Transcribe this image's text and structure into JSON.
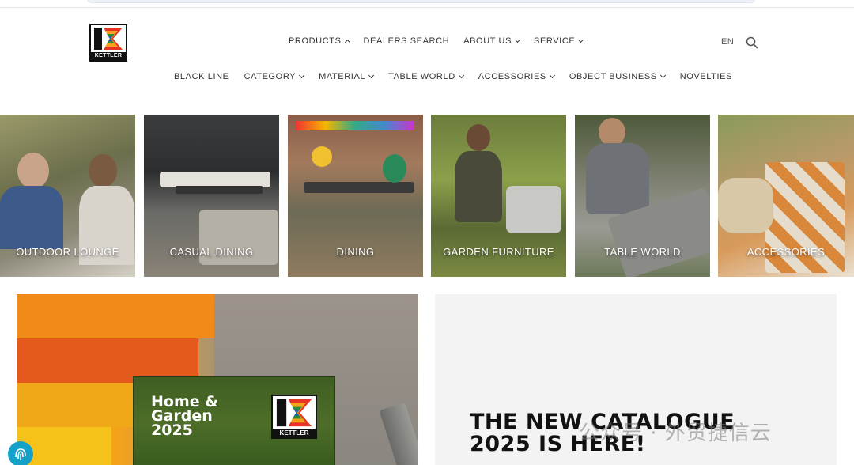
{
  "header": {
    "logo_text": "KETTLER",
    "primary_nav": [
      {
        "label": "PRODUCTS",
        "chevron": "up"
      },
      {
        "label": "DEALERS SEARCH",
        "chevron": ""
      },
      {
        "label": "ABOUT US",
        "chevron": "down"
      },
      {
        "label": "SERVICE",
        "chevron": "down"
      }
    ],
    "secondary_nav": [
      {
        "label": "BLACK LINE",
        "chevron": ""
      },
      {
        "label": "CATEGORY",
        "chevron": "down"
      },
      {
        "label": "MATERIAL",
        "chevron": "down"
      },
      {
        "label": "TABLE WORLD",
        "chevron": "down"
      },
      {
        "label": "ACCESSORIES",
        "chevron": "down"
      },
      {
        "label": "OBJECT BUSINESS",
        "chevron": "down"
      },
      {
        "label": "NOVELTIES",
        "chevron": ""
      }
    ],
    "language": "EN",
    "search_icon": "search-icon"
  },
  "categories": [
    {
      "label": "OUTDOOR LOUNGE"
    },
    {
      "label": "CASUAL DINING"
    },
    {
      "label": "DINING"
    },
    {
      "label": "GARDEN FURNITURE"
    },
    {
      "label": "TABLE WORLD"
    },
    {
      "label": "ACCESSORIES"
    }
  ],
  "promo": {
    "cover_title_line1": "Home &",
    "cover_title_line2": "Garden",
    "cover_title_line3": "2025",
    "cover_logo_text": "KETTLER",
    "headline_line1": "THE NEW CATALOGUE",
    "headline_line2": "2025 IS HERE!"
  },
  "overlay": {
    "watermark": "公众号 · 外贸捷信云"
  },
  "colors": {
    "accent_orange": "#ee7a16",
    "text_dark": "#111111",
    "promo_bg": "#f3f3f3"
  }
}
